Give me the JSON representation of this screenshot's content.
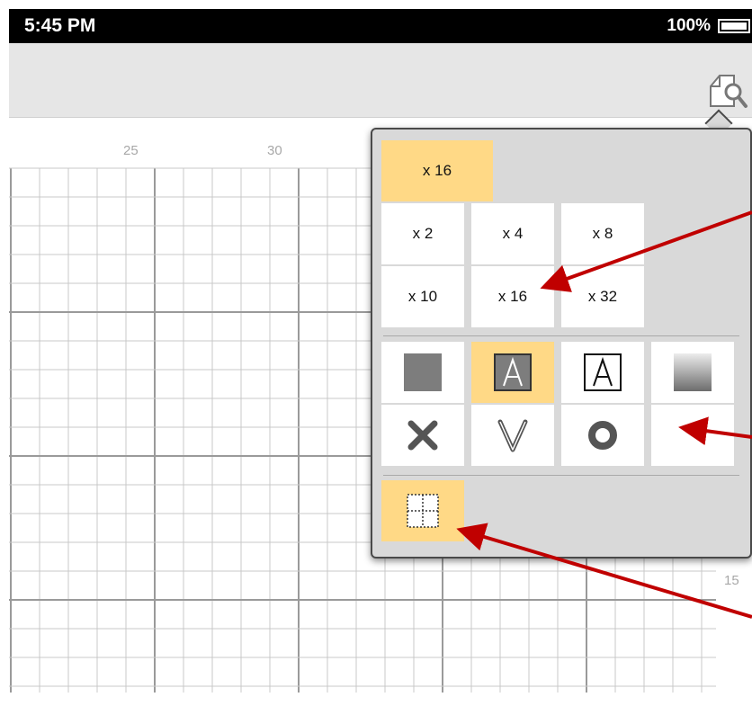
{
  "status_bar": {
    "time": "5:45 PM",
    "battery": "100%"
  },
  "toolbar": {
    "preview_icon": "document-zoom-icon"
  },
  "ruler": {
    "top_labels": [
      "25",
      "30"
    ],
    "right_label": "15"
  },
  "magnify_popover": {
    "current_zoom": "x 16",
    "zoom_options": [
      "x 2",
      "x 4",
      "x 8",
      "x 10",
      "x 16",
      "x 32"
    ],
    "selected_zoom": "x 16",
    "symbol_styles": [
      "filled-square-icon",
      "inverted-letter-a-icon",
      "outlined-letter-a-icon",
      "gradient-square-icon"
    ],
    "selected_symbol_style": "inverted-letter-a-icon",
    "mark_styles": [
      "x-mark-icon",
      "v-mark-icon",
      "circle-mark-icon"
    ],
    "grid_toggle": {
      "icon": "dotted-grid-icon",
      "active": true
    }
  },
  "colors": {
    "selected_highlight": "#ffd986",
    "popover_background": "#d9d9d9",
    "annotation_arrow": "#c00000",
    "grid_line": "#c8c8c8"
  }
}
